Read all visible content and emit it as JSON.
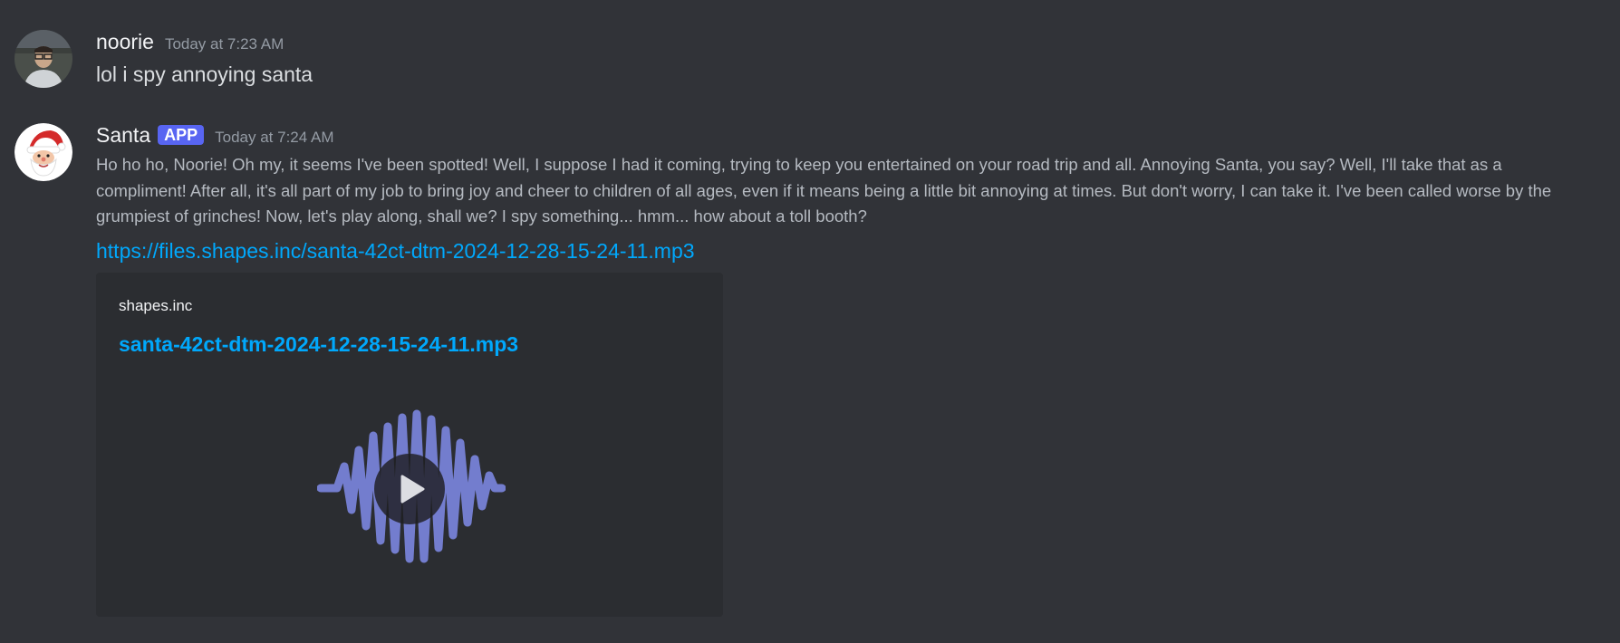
{
  "messages": [
    {
      "username": "noorie",
      "timestamp": "Today at 7:23 AM",
      "text": "lol i spy annoying santa",
      "avatar_icon": "user-avatar-photo"
    },
    {
      "username": "Santa",
      "badge": "APP",
      "timestamp": "Today at 7:24 AM",
      "text": "Ho ho ho, Noorie! Oh my, it seems I've been spotted! Well, I suppose I had it coming, trying to keep you entertained on your road trip and all. Annoying Santa, you say? Well, I'll take that as a compliment! After all, it's all part of my job to bring joy and cheer to children of all ages, even if it means being a little bit annoying at times. But don't worry, I can take it. I've been called worse by the grumpiest of grinches! Now, let's play along, shall we? I spy something... hmm... how about a toll booth?",
      "link": "https://files.shapes.inc/santa-42ct-dtm-2024-12-28-15-24-11.mp3",
      "avatar_icon": "santa-avatar",
      "embed": {
        "provider": "shapes.inc",
        "title": "santa-42ct-dtm-2024-12-28-15-24-11.mp3",
        "media_icon": "audio-waveform-icon",
        "play_icon": "play-icon"
      }
    }
  ],
  "colors": {
    "background": "#313338",
    "embed_background": "#2b2d31",
    "link": "#00a8fc",
    "badge": "#5865f2",
    "waveform": "#7b86e0"
  }
}
